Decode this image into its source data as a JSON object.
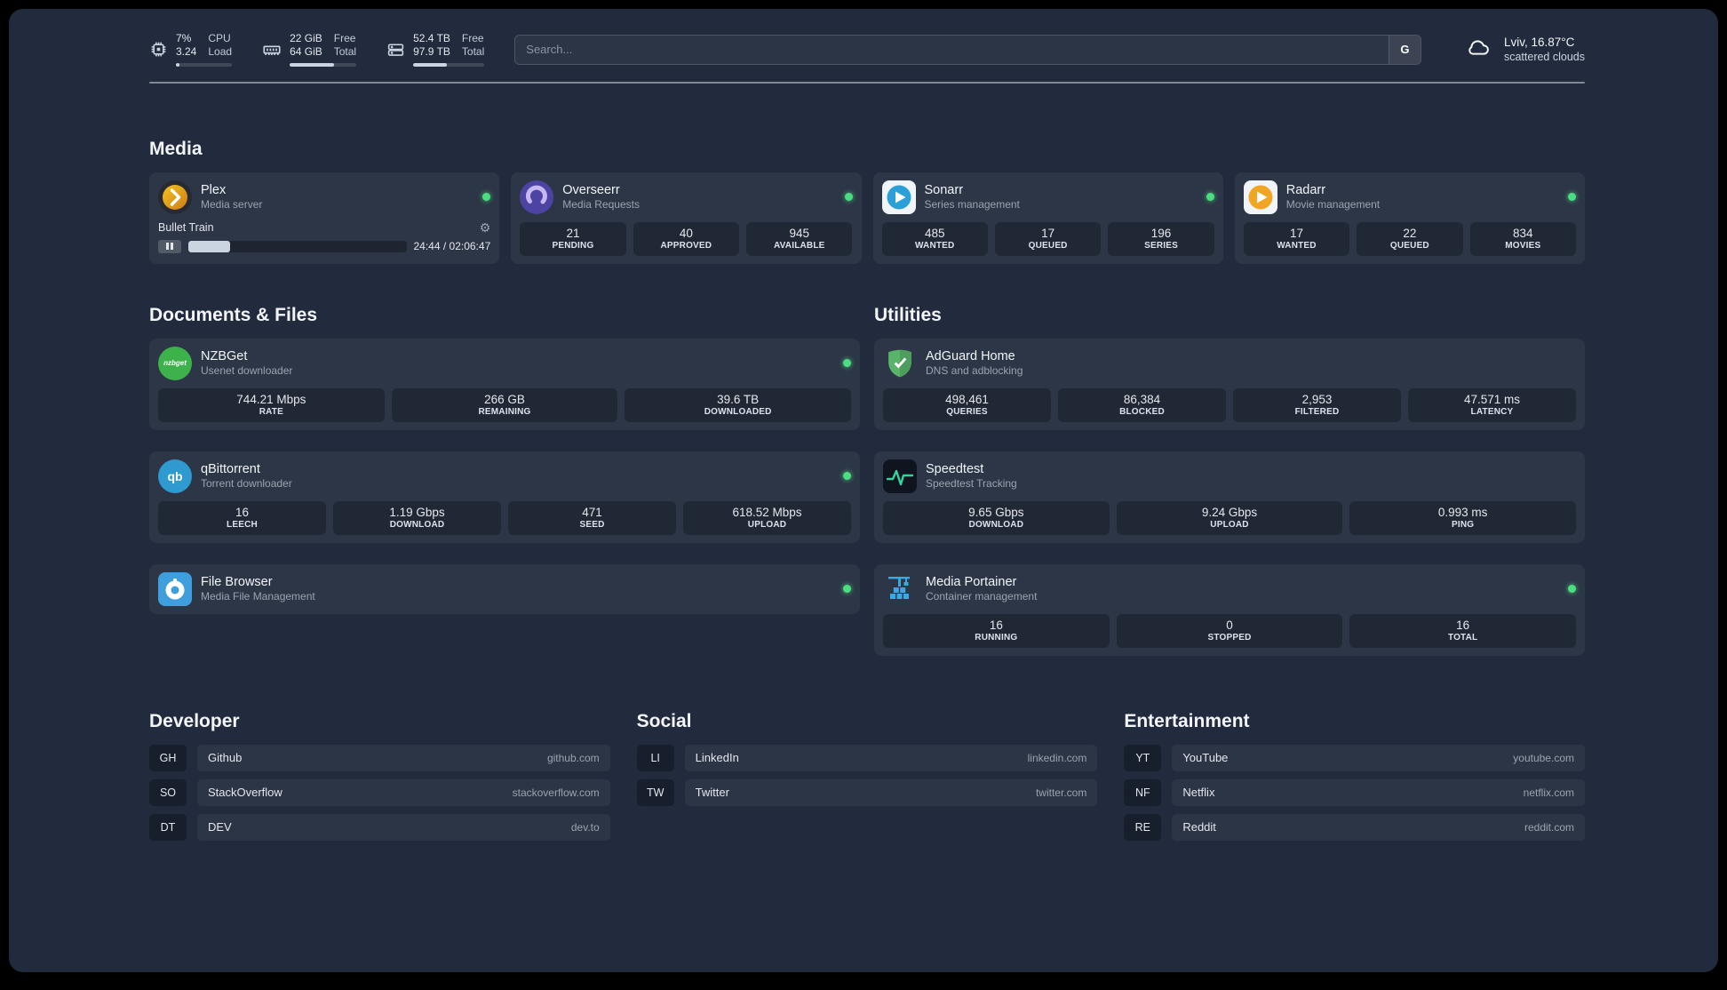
{
  "topbar": {
    "cpu": {
      "percent_label": "7%",
      "load": "3.24",
      "label_top": "CPU",
      "label_bottom": "Load",
      "bar_percent": 7
    },
    "memory": {
      "free": "22 GiB",
      "total": "64 GiB",
      "label_top": "Free",
      "label_bottom": "Total",
      "bar_percent": 66
    },
    "disk": {
      "free": "52.4 TB",
      "total": "97.9 TB",
      "label_top": "Free",
      "label_bottom": "Total",
      "bar_percent": 47
    },
    "search": {
      "placeholder": "Search...",
      "provider_button": "G"
    },
    "weather": {
      "location": "Lviv, 16.87°C",
      "condition": "scattered clouds"
    }
  },
  "sections": {
    "media": {
      "heading": "Media"
    },
    "documents": {
      "heading": "Documents & Files"
    },
    "utilities": {
      "heading": "Utilities"
    }
  },
  "icons": {
    "gear": "⚙"
  },
  "services": {
    "plex": {
      "title": "Plex",
      "subtitle": "Media server",
      "now_playing": "Bullet Train",
      "time": "24:44 / 02:06:47",
      "progress_percent": 19
    },
    "overseerr": {
      "title": "Overseerr",
      "subtitle": "Media Requests",
      "stats": [
        {
          "value": "21",
          "label": "PENDING"
        },
        {
          "value": "40",
          "label": "APPROVED"
        },
        {
          "value": "945",
          "label": "AVAILABLE"
        }
      ]
    },
    "sonarr": {
      "title": "Sonarr",
      "subtitle": "Series management",
      "stats": [
        {
          "value": "485",
          "label": "WANTED"
        },
        {
          "value": "17",
          "label": "QUEUED"
        },
        {
          "value": "196",
          "label": "SERIES"
        }
      ]
    },
    "radarr": {
      "title": "Radarr",
      "subtitle": "Movie management",
      "stats": [
        {
          "value": "17",
          "label": "WANTED"
        },
        {
          "value": "22",
          "label": "QUEUED"
        },
        {
          "value": "834",
          "label": "MOVIES"
        }
      ]
    },
    "nzbget": {
      "title": "NZBGet",
      "subtitle": "Usenet downloader",
      "icon_text": "nzbget",
      "stats": [
        {
          "value": "744.21 Mbps",
          "label": "RATE"
        },
        {
          "value": "266 GB",
          "label": "REMAINING"
        },
        {
          "value": "39.6 TB",
          "label": "DOWNLOADED"
        }
      ]
    },
    "qbittorrent": {
      "title": "qBittorrent",
      "subtitle": "Torrent downloader",
      "icon_text": "qb",
      "stats": [
        {
          "value": "16",
          "label": "LEECH"
        },
        {
          "value": "1.19 Gbps",
          "label": "DOWNLOAD"
        },
        {
          "value": "471",
          "label": "SEED"
        },
        {
          "value": "618.52 Mbps",
          "label": "UPLOAD"
        }
      ]
    },
    "filebrowser": {
      "title": "File Browser",
      "subtitle": "Media File Management"
    },
    "adguard": {
      "title": "AdGuard Home",
      "subtitle": "DNS and adblocking",
      "stats": [
        {
          "value": "498,461",
          "label": "QUERIES"
        },
        {
          "value": "86,384",
          "label": "BLOCKED"
        },
        {
          "value": "2,953",
          "label": "FILTERED"
        },
        {
          "value": "47.571 ms",
          "label": "LATENCY"
        }
      ]
    },
    "speedtest": {
      "title": "Speedtest",
      "subtitle": "Speedtest Tracking",
      "stats": [
        {
          "value": "9.65 Gbps",
          "label": "DOWNLOAD"
        },
        {
          "value": "9.24 Gbps",
          "label": "UPLOAD"
        },
        {
          "value": "0.993 ms",
          "label": "PING"
        }
      ]
    },
    "portainer": {
      "title": "Media Portainer",
      "subtitle": "Container management",
      "stats": [
        {
          "value": "16",
          "label": "RUNNING"
        },
        {
          "value": "0",
          "label": "STOPPED"
        },
        {
          "value": "16",
          "label": "TOTAL"
        }
      ]
    }
  },
  "bookmarks": {
    "developer": {
      "heading": "Developer",
      "items": [
        {
          "abbr": "GH",
          "name": "Github",
          "url": "github.com"
        },
        {
          "abbr": "SO",
          "name": "StackOverflow",
          "url": "stackoverflow.com"
        },
        {
          "abbr": "DT",
          "name": "DEV",
          "url": "dev.to"
        }
      ]
    },
    "social": {
      "heading": "Social",
      "items": [
        {
          "abbr": "LI",
          "name": "LinkedIn",
          "url": "linkedin.com"
        },
        {
          "abbr": "TW",
          "name": "Twitter",
          "url": "twitter.com"
        }
      ]
    },
    "entertainment": {
      "heading": "Entertainment",
      "items": [
        {
          "abbr": "YT",
          "name": "YouTube",
          "url": "youtube.com"
        },
        {
          "abbr": "NF",
          "name": "Netflix",
          "url": "netflix.com"
        },
        {
          "abbr": "RE",
          "name": "Reddit",
          "url": "reddit.com"
        }
      ]
    }
  },
  "colors": {
    "status_online": "#4ade80",
    "plex_brand": "#e5a00d",
    "sonarr_brand": "#2ba0d8",
    "radarr_brand": "#f0a622",
    "nzbget_brand": "#3db24a",
    "qbittorrent_brand": "#2e9ad0",
    "adguard_brand": "#59b368",
    "portainer_brand": "#3ba8e0"
  }
}
